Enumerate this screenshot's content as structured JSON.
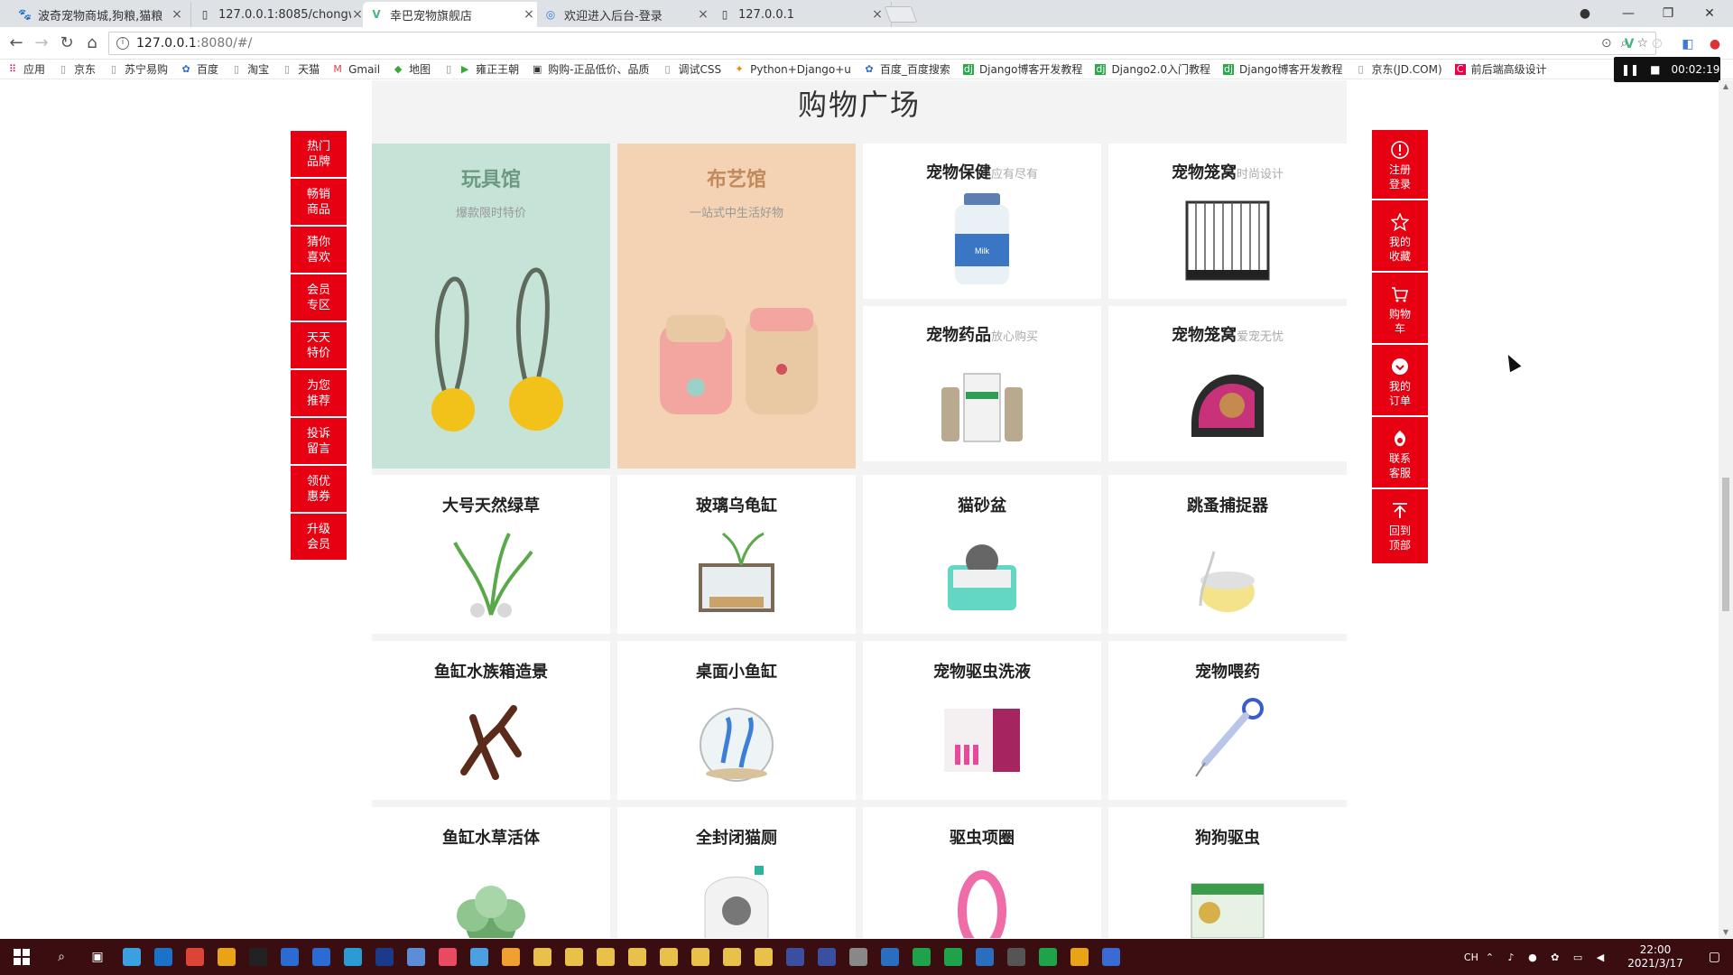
{
  "browser": {
    "tabs": [
      {
        "title": "波奇宠物商城,狗粮,猫粮",
        "icon": "paw-icon",
        "active": false
      },
      {
        "title": "127.0.0.1:8085/chongw",
        "icon": "page-icon",
        "active": false
      },
      {
        "title": "幸巴宠物旗舰店",
        "icon": "vue-icon",
        "active": true
      },
      {
        "title": "欢迎进入后台-登录",
        "icon": "globe-icon",
        "active": false
      },
      {
        "title": "127.0.0.1",
        "icon": "page-icon",
        "active": false
      }
    ],
    "address": {
      "host": "127.0.0.1",
      "path": ":8080/#/"
    },
    "bookmarks": [
      "应用",
      "京东",
      "苏宁易购",
      "百度",
      "淘宝",
      "天猫",
      "Gmail",
      "地图",
      "雍正王朝",
      "购购-正品低价、品质",
      "调试CSS",
      "Python+Django+u",
      "百度_百度搜索",
      "Django博客开发教程",
      "Django2.0入门教程",
      "Django博客开发教程",
      "京东(JD.COM)",
      "前后端高级设计"
    ]
  },
  "page": {
    "title": "购物广场",
    "side_nav": [
      [
        "热门",
        "品牌"
      ],
      [
        "畅销",
        "商品"
      ],
      [
        "猜你",
        "喜欢"
      ],
      [
        "会员",
        "专区"
      ],
      [
        "天天",
        "特价"
      ],
      [
        "为您",
        "推荐"
      ],
      [
        "投诉",
        "留言"
      ],
      [
        "领优",
        "惠券"
      ],
      [
        "升级",
        "会员"
      ]
    ],
    "features": [
      {
        "name": "玩具馆",
        "subtitle": "爆款限时特价",
        "color": "#c6e3d8",
        "title_color": "#6b9a80"
      },
      {
        "name": "布艺馆",
        "subtitle": "一站式中生活好物",
        "color": "#f3d3b3",
        "title_color": "#c08a5c"
      }
    ],
    "small_cards": [
      {
        "name": "宠物保健",
        "hint": "应有尽有"
      },
      {
        "name": "宠物笼窝",
        "hint": "时尚设计"
      },
      {
        "name": "宠物药品",
        "hint": "放心购买"
      },
      {
        "name": "宠物笼窝",
        "hint": "爱宠无忧"
      }
    ],
    "products": [
      "大号天然绿草",
      "玻璃乌龟缸",
      "猫砂盆",
      "跳蚤捕捉器",
      "鱼缸水族箱造景",
      "桌面小鱼缸",
      "宠物驱虫洗液",
      "宠物喂药",
      "鱼缸水草活体",
      "全封闭猫厕",
      "驱虫项圈",
      "狗狗驱虫"
    ],
    "right_bar": [
      {
        "label": "注册登录",
        "icon": "user-icon"
      },
      {
        "label": "我的收藏",
        "icon": "star-icon"
      },
      {
        "label": "购物车",
        "icon": "cart-icon"
      },
      {
        "label": "我的订单",
        "icon": "order-icon"
      },
      {
        "label": "联系客服",
        "icon": "service-icon"
      },
      {
        "label": "回到顶部",
        "icon": "arrow-up-icon"
      }
    ]
  },
  "recorder": {
    "time": "00:02:19"
  },
  "taskbar": {
    "time": "22:00",
    "date": "2021/3/17",
    "ime": "CH"
  },
  "colors": {
    "accent": "#e60012",
    "taskbar": "#3a0d10"
  }
}
